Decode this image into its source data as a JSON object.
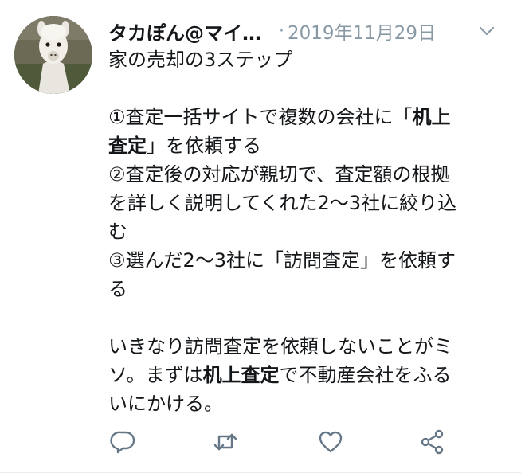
{
  "tweet": {
    "author_name": "タカぽん@マイ…",
    "separator": "·",
    "date": "2019年11月29日",
    "lines": {
      "l1": "家の売却の3ステップ",
      "l2a": "①査定一括サイトで複数の会社に「",
      "l2b": "机上",
      "l3a": "査定",
      "l3b": "」を依頼する",
      "l4": "②査定後の対応が親切で、査定額の根拠",
      "l5": "を詳しく説明してくれた2〜3社に絞り込",
      "l6": "む",
      "l7": "③選んだ2〜3社に「訪問査定」を依頼す",
      "l8": "る",
      "l9": "いきなり訪問査定を依頼しないことがミ",
      "l10a": "ソ。まずは",
      "l10b": "机上査定",
      "l10c": "で不動産会社をふる",
      "l11": "いにかける。"
    }
  },
  "icons": {
    "avatar": "alpaca-avatar",
    "menu": "chevron-down-icon",
    "reply": "reply-icon",
    "retweet": "retweet-icon",
    "like": "heart-icon",
    "share": "share-icon"
  },
  "colors": {
    "text": "#14171a",
    "meta": "#8899a6",
    "icon": "#657786",
    "divider": "#e6ecf0"
  }
}
